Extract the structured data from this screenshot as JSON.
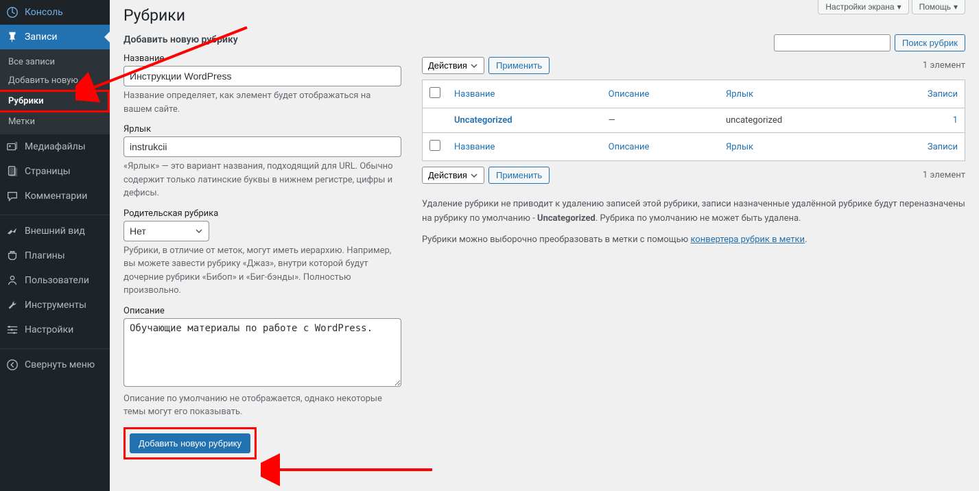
{
  "sidebar": {
    "items": [
      {
        "label": "Консоль",
        "icon": "dashboard"
      },
      {
        "label": "Записи",
        "icon": "pin",
        "current": true
      },
      {
        "label": "Медиафайлы",
        "icon": "media"
      },
      {
        "label": "Страницы",
        "icon": "page"
      },
      {
        "label": "Комментарии",
        "icon": "comment"
      },
      {
        "label": "Внешний вид",
        "icon": "appearance"
      },
      {
        "label": "Плагины",
        "icon": "plugin"
      },
      {
        "label": "Пользователи",
        "icon": "user"
      },
      {
        "label": "Инструменты",
        "icon": "tool"
      },
      {
        "label": "Настройки",
        "icon": "settings"
      },
      {
        "label": "Свернуть меню",
        "icon": "collapse"
      }
    ],
    "submenu": [
      {
        "label": "Все записи"
      },
      {
        "label": "Добавить новую"
      },
      {
        "label": "Рубрики",
        "current": true
      },
      {
        "label": "Метки"
      }
    ]
  },
  "top": {
    "screen_options": "Настройки экрана",
    "help": "Помощь"
  },
  "page": {
    "title": "Рубрики"
  },
  "form": {
    "heading": "Добавить новую рубрику",
    "name_label": "Название",
    "name_value": "Инструкции WordPress",
    "name_help": "Название определяет, как элемент будет отображаться на вашем сайте.",
    "slug_label": "Ярлык",
    "slug_value": "instrukcii",
    "slug_help": "«Ярлык» — это вариант названия, подходящий для URL. Обычно содержит только латинские буквы в нижнем регистре, цифры и дефисы.",
    "parent_label": "Родительская рубрика",
    "parent_value": "Нет",
    "parent_help": "Рубрики, в отличие от меток, могут иметь иерархию. Например, вы можете завести рубрику «Джаз», внутри которой будут дочерние рубрики «Бибоп» и «Биг-бэнды». Полностью произвольно.",
    "desc_label": "Описание",
    "desc_value": "Обучающие материалы по работе с WordPress.",
    "desc_help": "Описание по умолчанию не отображается, однако некоторые темы могут его показывать.",
    "submit": "Добавить новую рубрику"
  },
  "table": {
    "search_btn": "Поиск рубрик",
    "bulk_label": "Действия",
    "apply": "Применить",
    "count": "1 элемент",
    "cols": {
      "name": "Название",
      "desc": "Описание",
      "slug": "Ярлык",
      "posts": "Записи"
    },
    "rows": [
      {
        "name": "Uncategorized",
        "desc": "—",
        "slug": "uncategorized",
        "posts": "1"
      }
    ]
  },
  "notes": {
    "p1_a": "Удаление рубрики не приводит к удалению записей этой рубрики, записи назначенные удалённой рубрике будут переназначены на рубрику по умолчанию - ",
    "p1_b": "Uncategorized",
    "p1_c": ". Рубрика по умолчанию не может быть удалена.",
    "p2_a": "Рубрики можно выборочно преобразовать в метки с помощью ",
    "p2_link": "конвертера рубрик в метки",
    "p2_b": "."
  }
}
